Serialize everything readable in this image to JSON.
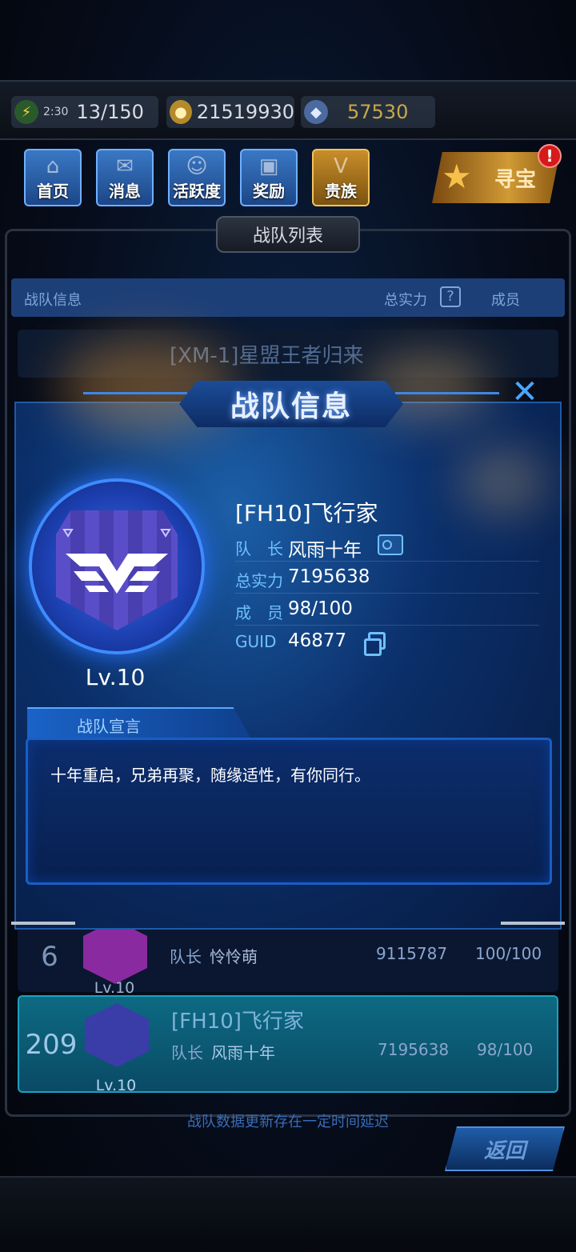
{
  "resources": {
    "energy_timer": "2:30",
    "energy": "13/150",
    "coins": "21519930",
    "gems": "57530"
  },
  "nav": [
    {
      "label": "首页",
      "icon": "home-icon"
    },
    {
      "label": "消息",
      "icon": "mail-icon"
    },
    {
      "label": "活跃度",
      "icon": "smile-icon"
    },
    {
      "label": "奖励",
      "icon": "gift-icon"
    },
    {
      "label": "贵族",
      "icon": "noble-icon"
    }
  ],
  "treasure": {
    "label": "寻宝",
    "badge": "!"
  },
  "list": {
    "title": "战队列表",
    "headers": {
      "info": "战队信息",
      "power": "总实力",
      "members": "成员"
    },
    "rows": [
      {
        "name": "[XM-1]星盟王者归来"
      },
      {
        "rank": "6",
        "captain_label": "队长",
        "captain": "怜怜萌",
        "power": "9115787",
        "members": "100/100",
        "level": "Lv.10"
      },
      {
        "rank": "209",
        "name": "[FH10]飞行家",
        "captain_label": "队长",
        "captain": "风雨十年",
        "power": "7195638",
        "members": "98/100",
        "level": "Lv.10"
      }
    ],
    "footnote": "战队数据更新存在一定时间延迟",
    "back": "返回"
  },
  "modal": {
    "title": "战队信息",
    "close": "✕",
    "level": "Lv.10",
    "team_name": "[FH10]飞行家",
    "fields": [
      {
        "key": "队　长",
        "value": "风雨十年"
      },
      {
        "key": "总实力",
        "value": "7195638"
      },
      {
        "key": "成　员",
        "value": "98/100"
      },
      {
        "key": "GUID",
        "value": "46877"
      }
    ],
    "declaration_label": "战队宣言",
    "declaration": "十年重启，兄弟再聚，随缘适性，有你同行。"
  },
  "colors": {
    "accent": "#3e8cff",
    "label_blue": "#6fc0ff",
    "highlight_row": "#0d6a82",
    "gold": "#d19a35"
  }
}
